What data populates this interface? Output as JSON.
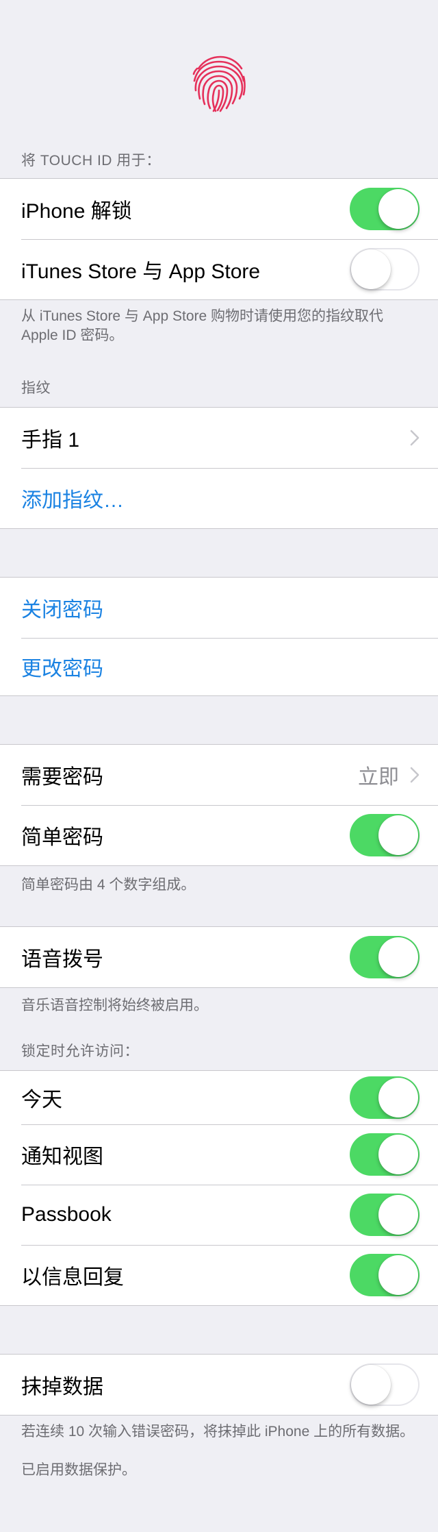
{
  "touch_id": {
    "header": "将 TOUCH ID 用于：",
    "rows": [
      {
        "label": "iPhone 解锁",
        "on": true
      },
      {
        "label": "iTunes Store 与 App Store",
        "on": false
      }
    ],
    "footer": "从 iTunes Store 与 App Store 购物时请使用您的指纹取代 Apple ID 密码。"
  },
  "fingerprints": {
    "header": "指纹",
    "finger1": "手指 1",
    "add": "添加指纹…"
  },
  "passcode": {
    "turn_off": "关闭密码",
    "change": "更改密码"
  },
  "require": {
    "label": "需要密码",
    "value": "立即",
    "simple_label": "简单密码",
    "simple_on": true,
    "footer": "简单密码由 4 个数字组成。"
  },
  "voice": {
    "label": "语音拨号",
    "on": true,
    "footer": "音乐语音控制将始终被启用。"
  },
  "lock_access": {
    "header": "锁定时允许访问：",
    "rows": [
      {
        "label": "今天",
        "on": true
      },
      {
        "label": "通知视图",
        "on": true
      },
      {
        "label": "Passbook",
        "on": true
      },
      {
        "label": "以信息回复",
        "on": true
      }
    ]
  },
  "erase": {
    "label": "抹掉数据",
    "on": false,
    "footer1": "若连续 10 次输入错误密码，将抹掉此 iPhone 上的所有数据。",
    "footer2": "已启用数据保护。"
  },
  "colors": {
    "accent": "#1a82e2",
    "toggle_on": "#4cd964",
    "fingerprint": "#e5305a",
    "background": "#efeff4"
  }
}
